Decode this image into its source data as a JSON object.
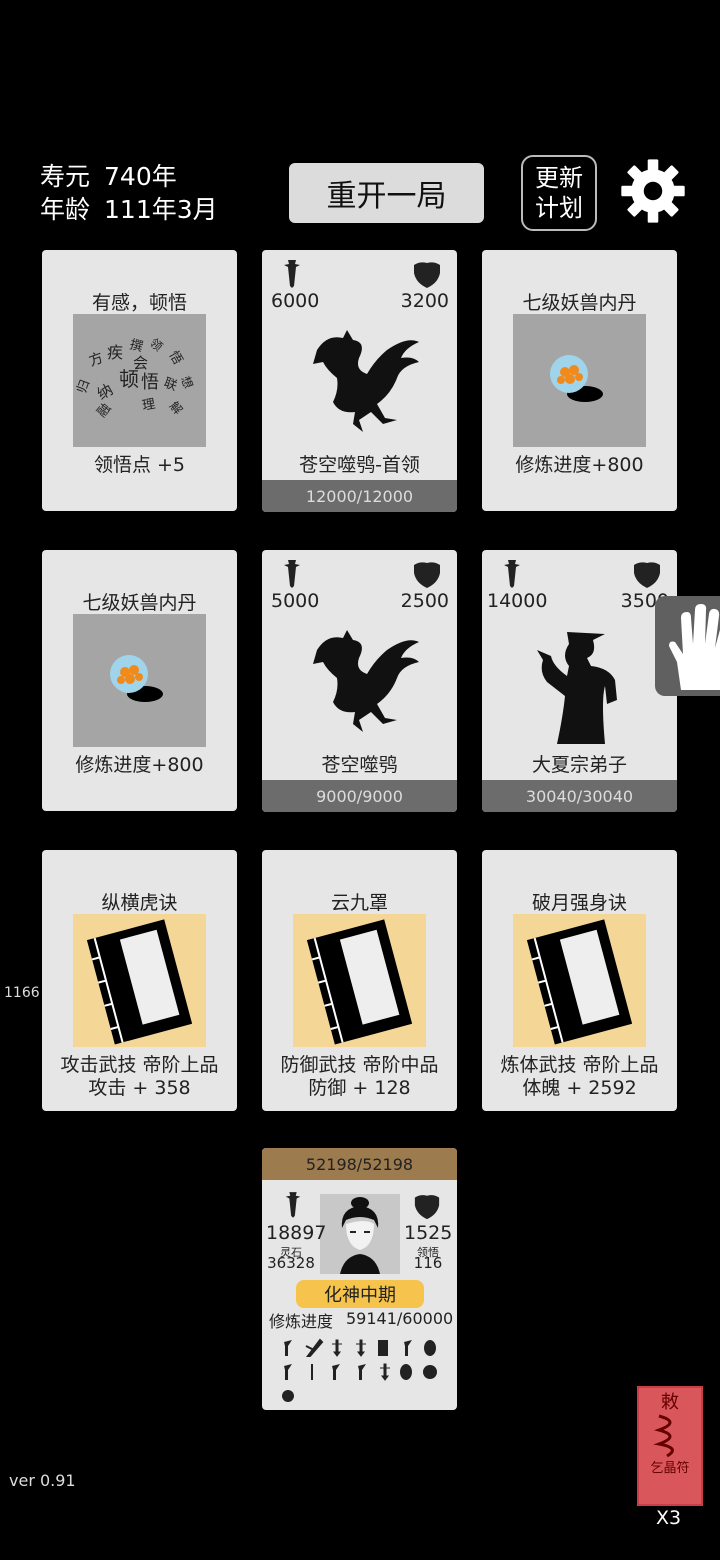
{
  "header": {
    "lifespan_label": "寿元",
    "lifespan_value": "740年",
    "age_label": "年龄",
    "age_value": "111年3月",
    "restart_label": "重开一局",
    "plan_line1": "更新",
    "plan_line2": "计划"
  },
  "row1": {
    "card1": {
      "title": "有感，顿悟",
      "desc": "领悟点  +5",
      "word_cloud": [
        "方",
        "疾",
        "撰",
        "领",
        "悟",
        "会",
        "归",
        "纳",
        "顿",
        "悟",
        "联",
        "想",
        "融",
        "理",
        "解"
      ]
    },
    "card2": {
      "atk": "6000",
      "def": "3200",
      "name": "苍空噬鸮-首领",
      "hp": "12000/12000"
    },
    "card3": {
      "title": "七级妖兽内丹",
      "desc": "修炼进度+800"
    }
  },
  "row2": {
    "card1": {
      "title": "七级妖兽内丹",
      "desc": "修炼进度+800"
    },
    "card2": {
      "atk": "5000",
      "def": "2500",
      "name": "苍空噬鸮",
      "hp": "9000/9000"
    },
    "card3": {
      "atk": "14000",
      "def": "3500",
      "name": "大夏宗弟子",
      "hp": "30040/30040"
    }
  },
  "row3": {
    "card1": {
      "title": "纵横虎诀",
      "line1": "攻击武技  帝阶上品",
      "line2": "攻击 + 358"
    },
    "card2": {
      "title": "云九罩",
      "line1": "防御武技  帝阶中品",
      "line2": "防御 + 128"
    },
    "card3": {
      "title": "破月强身诀",
      "line1": "炼体武技  帝阶上品",
      "line2": "体魄 + 2592"
    }
  },
  "side_number": "1166",
  "player": {
    "hp": "52198/52198",
    "atk": "18897",
    "def": "1525",
    "spirit_stone_label": "灵石",
    "spirit_stone": "36328",
    "insight_label": "领悟",
    "insight": "116",
    "realm": "化神中期",
    "progress_label": "修炼进度",
    "progress": "59141/60000",
    "inventory_icons": [
      "axe-icon",
      "feather-icon",
      "sword-icon",
      "sword-icon",
      "armor-icon",
      "axe-icon",
      "beetle-icon",
      "axe-icon",
      "dagger-icon",
      "axe-icon",
      "axe-icon",
      "sword-icon",
      "beetle-icon",
      "orb-icon",
      "beetle-icon"
    ]
  },
  "talisman": {
    "glyph_top": "敕",
    "glyph_bottom": "乞晶符",
    "multiplier": "X3"
  },
  "version": "ver 0.91"
}
